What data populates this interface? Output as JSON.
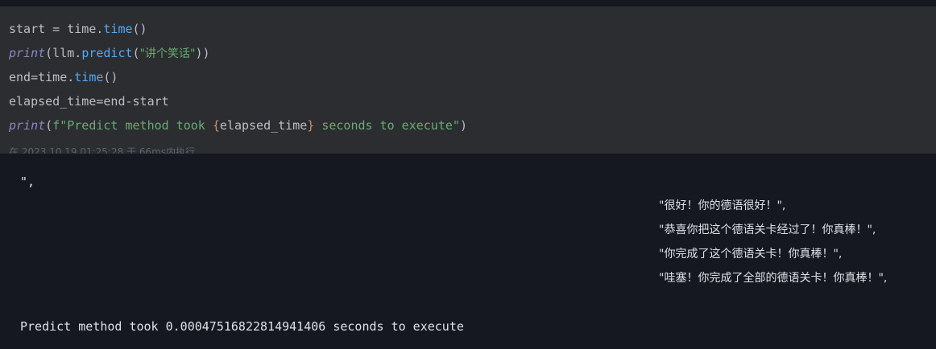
{
  "code": {
    "line1": {
      "a": "start = time.",
      "b": "time",
      "c": "()"
    },
    "line2": {
      "a": "print",
      "b": "(llm.",
      "c": "predict",
      "d": "(",
      "e": "\"讲个笑话\"",
      "f": "))"
    },
    "line3": {
      "a": "end=time.",
      "b": "time",
      "c": "()"
    },
    "line4": {
      "a": "elapsed_time=end-start"
    },
    "line5": {
      "a": "print",
      "b": "(",
      "c": "f\"Predict method took ",
      "d": "{",
      "e": "elapsed_time",
      "f": "}",
      "g": " seconds to execute\"",
      "h": ")"
    }
  },
  "execution_meta": "在 2023.10.19 01:25:28 于 66ms内执行",
  "output": {
    "line1": "\",",
    "line2": "\"很好！你的德语很好！\",",
    "line3": "\"恭喜你把这个德语关卡经过了！你真棒！\",",
    "line4": "\"你完成了这个德语关卡！你真棒！\",",
    "line5": "\"哇塞！你完成了全部的德语关卡！你真棒！\",",
    "line6": "Predict method took 0.00047516822814941406 seconds to execute"
  }
}
